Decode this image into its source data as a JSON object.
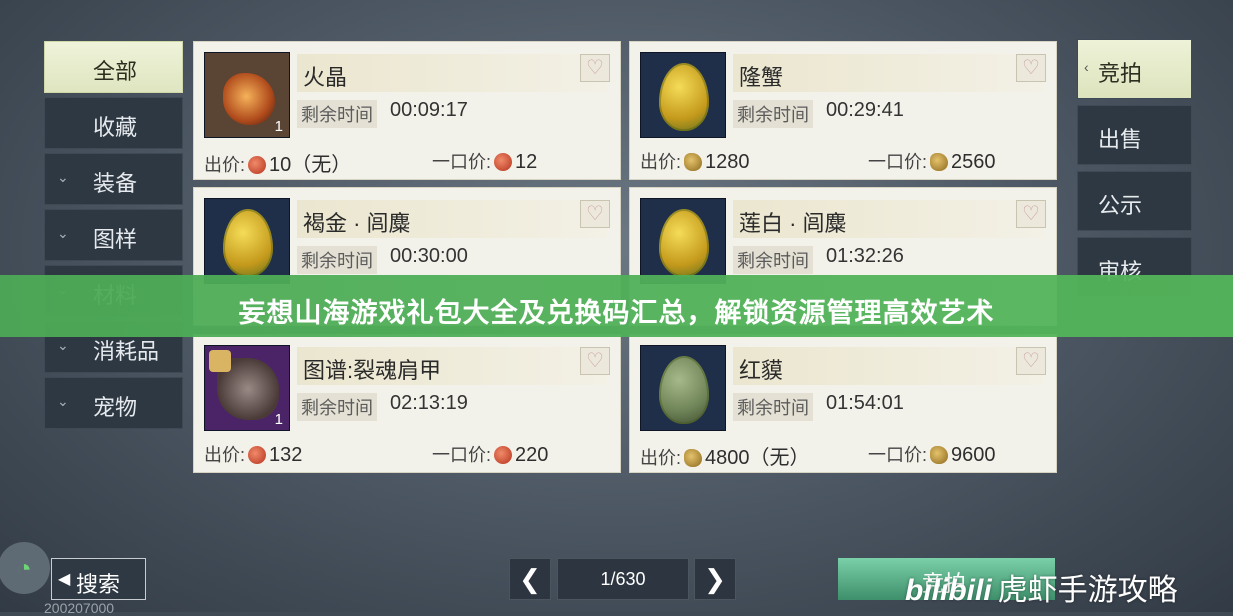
{
  "sidebar": {
    "items": [
      {
        "label": "全部",
        "chevron": ""
      },
      {
        "label": "收藏",
        "chevron": ""
      },
      {
        "label": "装备",
        "chevron": "⌄"
      },
      {
        "label": "图样",
        "chevron": "⌄"
      },
      {
        "label": "材料",
        "chevron": "⌄"
      },
      {
        "label": "消耗品",
        "chevron": "⌄"
      },
      {
        "label": "宠物",
        "chevron": "⌄"
      }
    ]
  },
  "right_tabs": {
    "items": [
      {
        "label": "竞拍"
      },
      {
        "label": "出售"
      },
      {
        "label": "公示"
      },
      {
        "label": "审核"
      }
    ]
  },
  "cards": [
    {
      "name": "火晶",
      "time_label": "剩余时间",
      "time": "00:09:17",
      "qty": "1",
      "bid_label": "出价:",
      "bid": "10（无）",
      "buyout_label": "一口价:",
      "buyout": "12",
      "currency": "red"
    },
    {
      "name": "隆蟹",
      "time_label": "剩余时间",
      "time": "00:29:41",
      "qty": "",
      "bid_label": "出价:",
      "bid": "1280",
      "buyout_label": "一口价:",
      "buyout": "2560",
      "currency": "seed"
    },
    {
      "name": "褐金 · 闾麋",
      "time_label": "剩余时间",
      "time": "00:30:00",
      "qty": "",
      "bid_label": "出价:",
      "bid": "",
      "buyout_label": "一口价:",
      "buyout": "",
      "currency": "red"
    },
    {
      "name": "莲白 · 闾麋",
      "time_label": "剩余时间",
      "time": "01:32:26",
      "qty": "",
      "bid_label": "出价:",
      "bid": "",
      "buyout_label": "一口价:",
      "buyout": "",
      "currency": "seed"
    },
    {
      "name": "图谱:裂魂肩甲",
      "time_label": "剩余时间",
      "time": "02:13:19",
      "qty": "1",
      "bid_label": "出价:",
      "bid": "132",
      "buyout_label": "一口价:",
      "buyout": "220",
      "currency": "red"
    },
    {
      "name": "红貘",
      "time_label": "剩余时间",
      "time": "01:54:01",
      "qty": "",
      "bid_label": "出价:",
      "bid": "4800（无）",
      "buyout_label": "一口价:",
      "buyout": "9600",
      "currency": "seed"
    }
  ],
  "banner": {
    "text": "妄想山海游戏礼包大全及兑换码汇总，解锁资源管理高效艺术"
  },
  "bottom": {
    "search_label": "搜索",
    "page": "1/630",
    "bid_button": "竞拍",
    "bottom_id": "200207000"
  },
  "watermark": {
    "bili": "bilibili",
    "text": "虎虾手游攻略"
  },
  "colors": {
    "banner": "#4caa56",
    "active_tab": "#eef2d8",
    "card": "#f3f2ea"
  }
}
